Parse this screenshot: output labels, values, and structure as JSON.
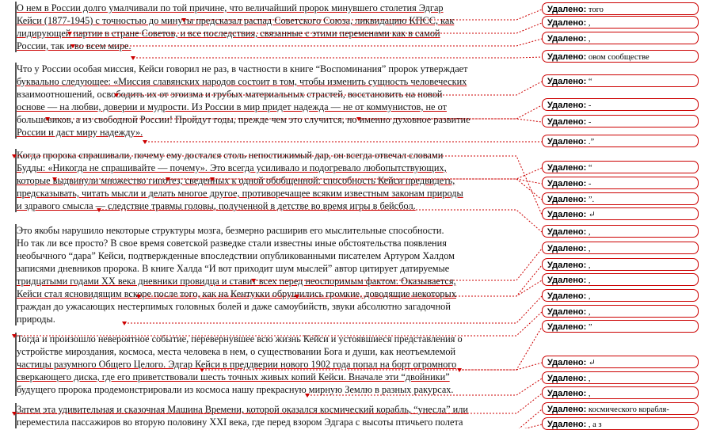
{
  "document": {
    "paragraphs": [
      {
        "lines": [
          "О нем в России долго умалчивали по той причине, что величайший пророк минувшего столетия Эдгар",
          "Кейси (1877-1945) с точностью до минуты предсказал распад Советского Союза, ликвидацию КПСС, как",
          "лидирующей партии в стране Советов, и все последствия, связанные с этими переменами как в самой",
          "России, так и во всем мире."
        ]
      },
      {
        "lines": [
          "Что у России особая миссия, Кейси говорил не раз, в частности в книге “Воспоминания” пророк утверждает",
          "буквально следующее: «Миссия славянских народов состоит в том, чтобы изменить сущность человеческих",
          "взаимоотношений, освободить их от эгоизма и грубых материальных страстей, восстановить на новой",
          "основе — на любви, доверии и мудрости. Из России в мир придет надежда — не от коммунистов, не от",
          "большевиков, а из свободной России! Пройдут годы, прежде чем это случится, но именно духовное развитие",
          "России и даст миру надежду»."
        ]
      },
      {
        "lines": [
          "Когда пророка спрашивали, почему ему достался столь непостижимый дар, он всегда отвечал словами",
          "Будды: «Никогда не спрашивайте — почему». Это всегда усиливало и подогревало любопытствующих,",
          "которые выдвинули множество гипотез, сведенных к одной обобщенной: способность Кейси предвидеть,",
          "предсказывать, читать мысли и делать многое другое, противоречащее всяким известным законам природы",
          "и здравого смысла — следствие травмы головы, полученной в детстве во время игры в бейсбол."
        ]
      },
      {
        "lines": [
          "Это якобы нарушило некоторые структуры мозга, безмерно расширив его мыслительные способности.",
          "Но так ли все просто? В свое время советской разведке стали известны иные обстоятельства появления",
          "необычного “дара” Кейси, подтвержденные впоследствии опубликованными писателем Артуром Халдом",
          "записями дневников пророка. В книге Халда “И вот приходит шум мыслей” автор цитирует датируемые",
          "тридцатыми годами XX века дневники провидца и ставит всех перед неоспоримым фактом. Оказывается,",
          "Кейси стал ясновидящим вскоре после того, как на Кентукки обрушились громкие, доводящие некоторых",
          "граждан до ужасающих нестерпимых головных болей и даже самоубийств, звуки абсолютно загадочной",
          "природы."
        ]
      },
      {
        "lines": [
          "Тогда и произошло невероятное событие, перевернувшее всю жизнь Кейси и устоявшиеся представления о",
          "устройстве мироздания, космоса, места человека в нем, о существовании Бога и души, как неотъемлемой",
          "частицы разумного Общего Целого. Эдгар Кейси в преддверии нового 1902 года попал на борт огромного",
          "сверкающего диска, где его приветствовали шесть точных живых копий Кейси. Вначале эти “двойники”",
          "будущего пророка продемонстрировали из космоса нашу прекрасную мирную Землю в разных ракурсах."
        ]
      },
      {
        "lines": [
          "Затем эта удивительная и сказочная Машина Времени, которой оказался космический корабль, “унесла” или",
          "переместила пассажиров во вторую половину XXI века, где перед взором Эдгара с высоты птичьего полета"
        ]
      }
    ]
  },
  "revisions": {
    "label": "Удалено:",
    "items": [
      {
        "text": "того"
      },
      {
        "text": ","
      },
      {
        "text": ","
      },
      {
        "text": "овом сообществе"
      },
      {
        "text": "“"
      },
      {
        "text": "-"
      },
      {
        "text": "-"
      },
      {
        "text": ".”"
      },
      {
        "text": "“"
      },
      {
        "text": "-"
      },
      {
        "text": "”."
      },
      {
        "text": "↵"
      },
      {
        "text": ","
      },
      {
        "text": ","
      },
      {
        "text": ","
      },
      {
        "text": ","
      },
      {
        "text": ","
      },
      {
        "text": ","
      },
      {
        "text": "”"
      },
      {
        "text": "↵"
      },
      {
        "text": ","
      },
      {
        "text": ","
      },
      {
        "text": "космического корабля-"
      },
      {
        "text": ", а з"
      }
    ]
  },
  "colors": {
    "revision": "#cc0000",
    "gutter_divider": "#e6e6e6"
  }
}
